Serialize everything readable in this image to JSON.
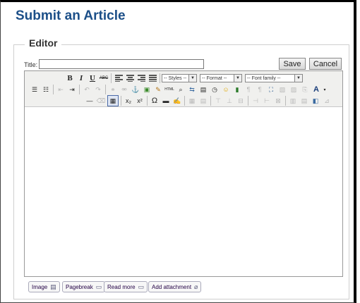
{
  "page": {
    "title": "Submit an Article"
  },
  "editor": {
    "legend": "Editor",
    "title_label": "Title:",
    "title_value": "",
    "save_label": "Save",
    "cancel_label": "Cancel",
    "toolbar": {
      "row1": {
        "bold": "B",
        "italic": "I",
        "underline": "U",
        "strike": "ABC",
        "styles": "-- Styles --",
        "format": "-- Format --",
        "font_family": "-- Font family --"
      },
      "row3": {
        "subscript": "x₂",
        "superscript": "x²",
        "omega": "Ω"
      }
    }
  },
  "footer_buttons": {
    "image": "Image",
    "pagebreak": "Pagebreak",
    "readmore": "Read more",
    "attachment": "Add attachment"
  }
}
